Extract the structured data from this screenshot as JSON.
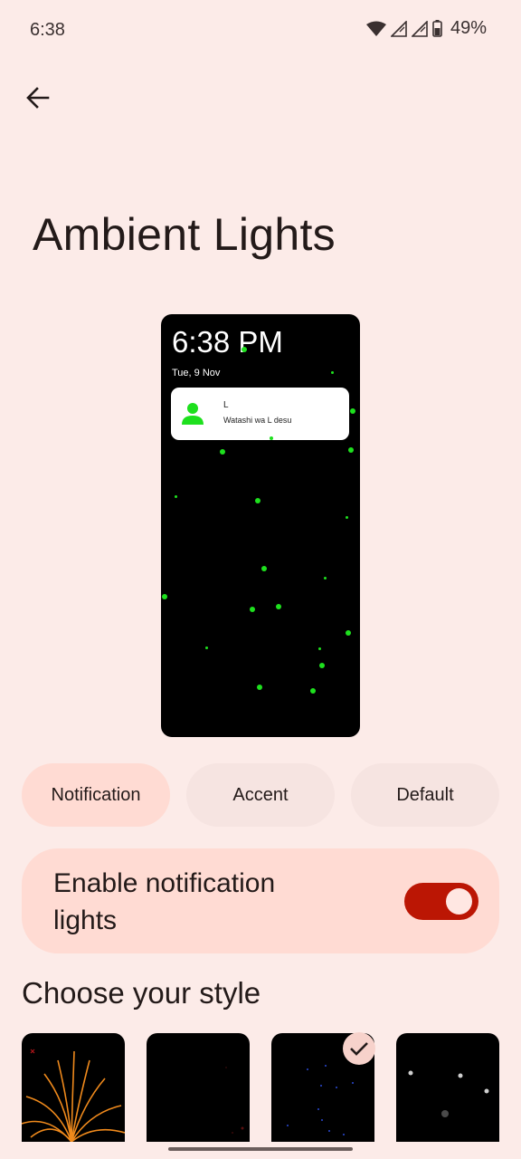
{
  "status_bar": {
    "time": "6:38",
    "battery_percent": "49%",
    "icons": [
      "wifi-icon",
      "signal-icon",
      "signal-icon",
      "battery-icon"
    ]
  },
  "header": {
    "back_icon": "back-arrow-icon",
    "title": "Ambient Lights"
  },
  "preview": {
    "time": "6:38 PM",
    "date": "Tue, 9 Nov",
    "notification": {
      "title": "L",
      "text": "Watashi wa L desu",
      "avatar_icon": "person-icon"
    },
    "particle_color": "#1ee01e"
  },
  "modes": [
    {
      "label": "Notification",
      "selected": true
    },
    {
      "label": "Accent",
      "selected": false
    },
    {
      "label": "Default",
      "selected": false
    }
  ],
  "enable": {
    "label": "Enable notification lights",
    "on": true,
    "accent": "#bb1604"
  },
  "styles": {
    "title": "Choose your style",
    "items": [
      {
        "name": "fireworks-style",
        "selected": false
      },
      {
        "name": "dark-style",
        "selected": false
      },
      {
        "name": "particles-style",
        "selected": true
      },
      {
        "name": "stars-style",
        "selected": false
      }
    ]
  }
}
